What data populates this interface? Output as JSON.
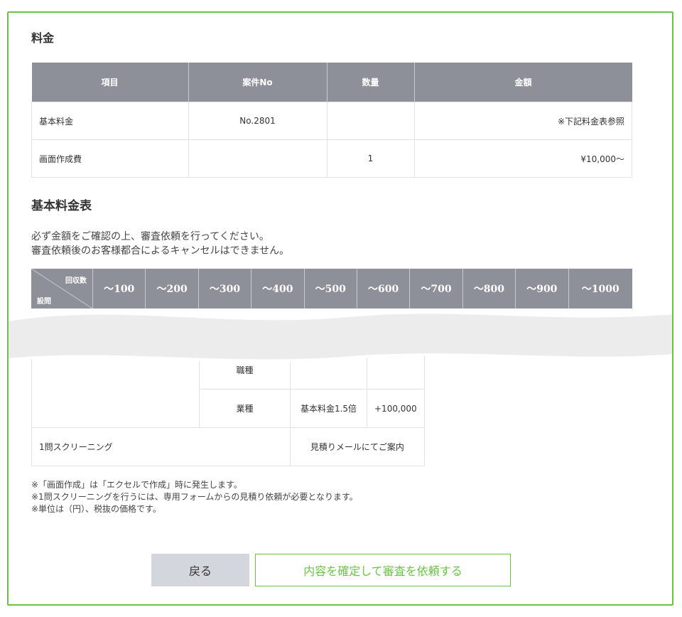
{
  "fee": {
    "title": "料金",
    "headers": [
      "項目",
      "案件No",
      "数量",
      "金額"
    ],
    "rows": [
      {
        "item": "基本料金",
        "case_no": "No.2801",
        "qty": "",
        "amount": "※下記料金表参照"
      },
      {
        "item": "画面作成費",
        "case_no": "",
        "qty": "1",
        "amount": "¥10,000～"
      }
    ]
  },
  "basic": {
    "title": "基本料金表",
    "notes": [
      "必ず金額をご確認の上、審査依頼を行ってください。",
      "審査依頼後のお客様都合によるキャンセルはできません。"
    ],
    "diag_top": "回収数",
    "diag_bottom": "設問",
    "columns": [
      "～100",
      "～200",
      "～300",
      "～400",
      "～500",
      "～600",
      "～700",
      "～800",
      "～900",
      "～1000"
    ]
  },
  "lower": {
    "rows": [
      {
        "label": "",
        "sub": "職種",
        "value1": "",
        "value2": ""
      },
      {
        "label": "",
        "sub": "業種",
        "value1": "基本料金1.5倍",
        "value2": "+100,000"
      },
      {
        "label": "1問スクリーニング",
        "sub": "",
        "value": "見積りメールにてご案内"
      }
    ]
  },
  "footnotes": [
    "※「画面作成」は「エクセルで作成」時に発生します。",
    "※1問スクリーニングを行うには、専用フォームからの見積り依頼が必要となります。",
    "※単位は（円）、税抜の価格です。"
  ],
  "buttons": {
    "back": "戻る",
    "submit": "内容を確定して審査を依頼する"
  },
  "colors": {
    "accent": "#6cc04a",
    "header_bg": "#8d8f99",
    "back_button": "#d3d6dc"
  }
}
